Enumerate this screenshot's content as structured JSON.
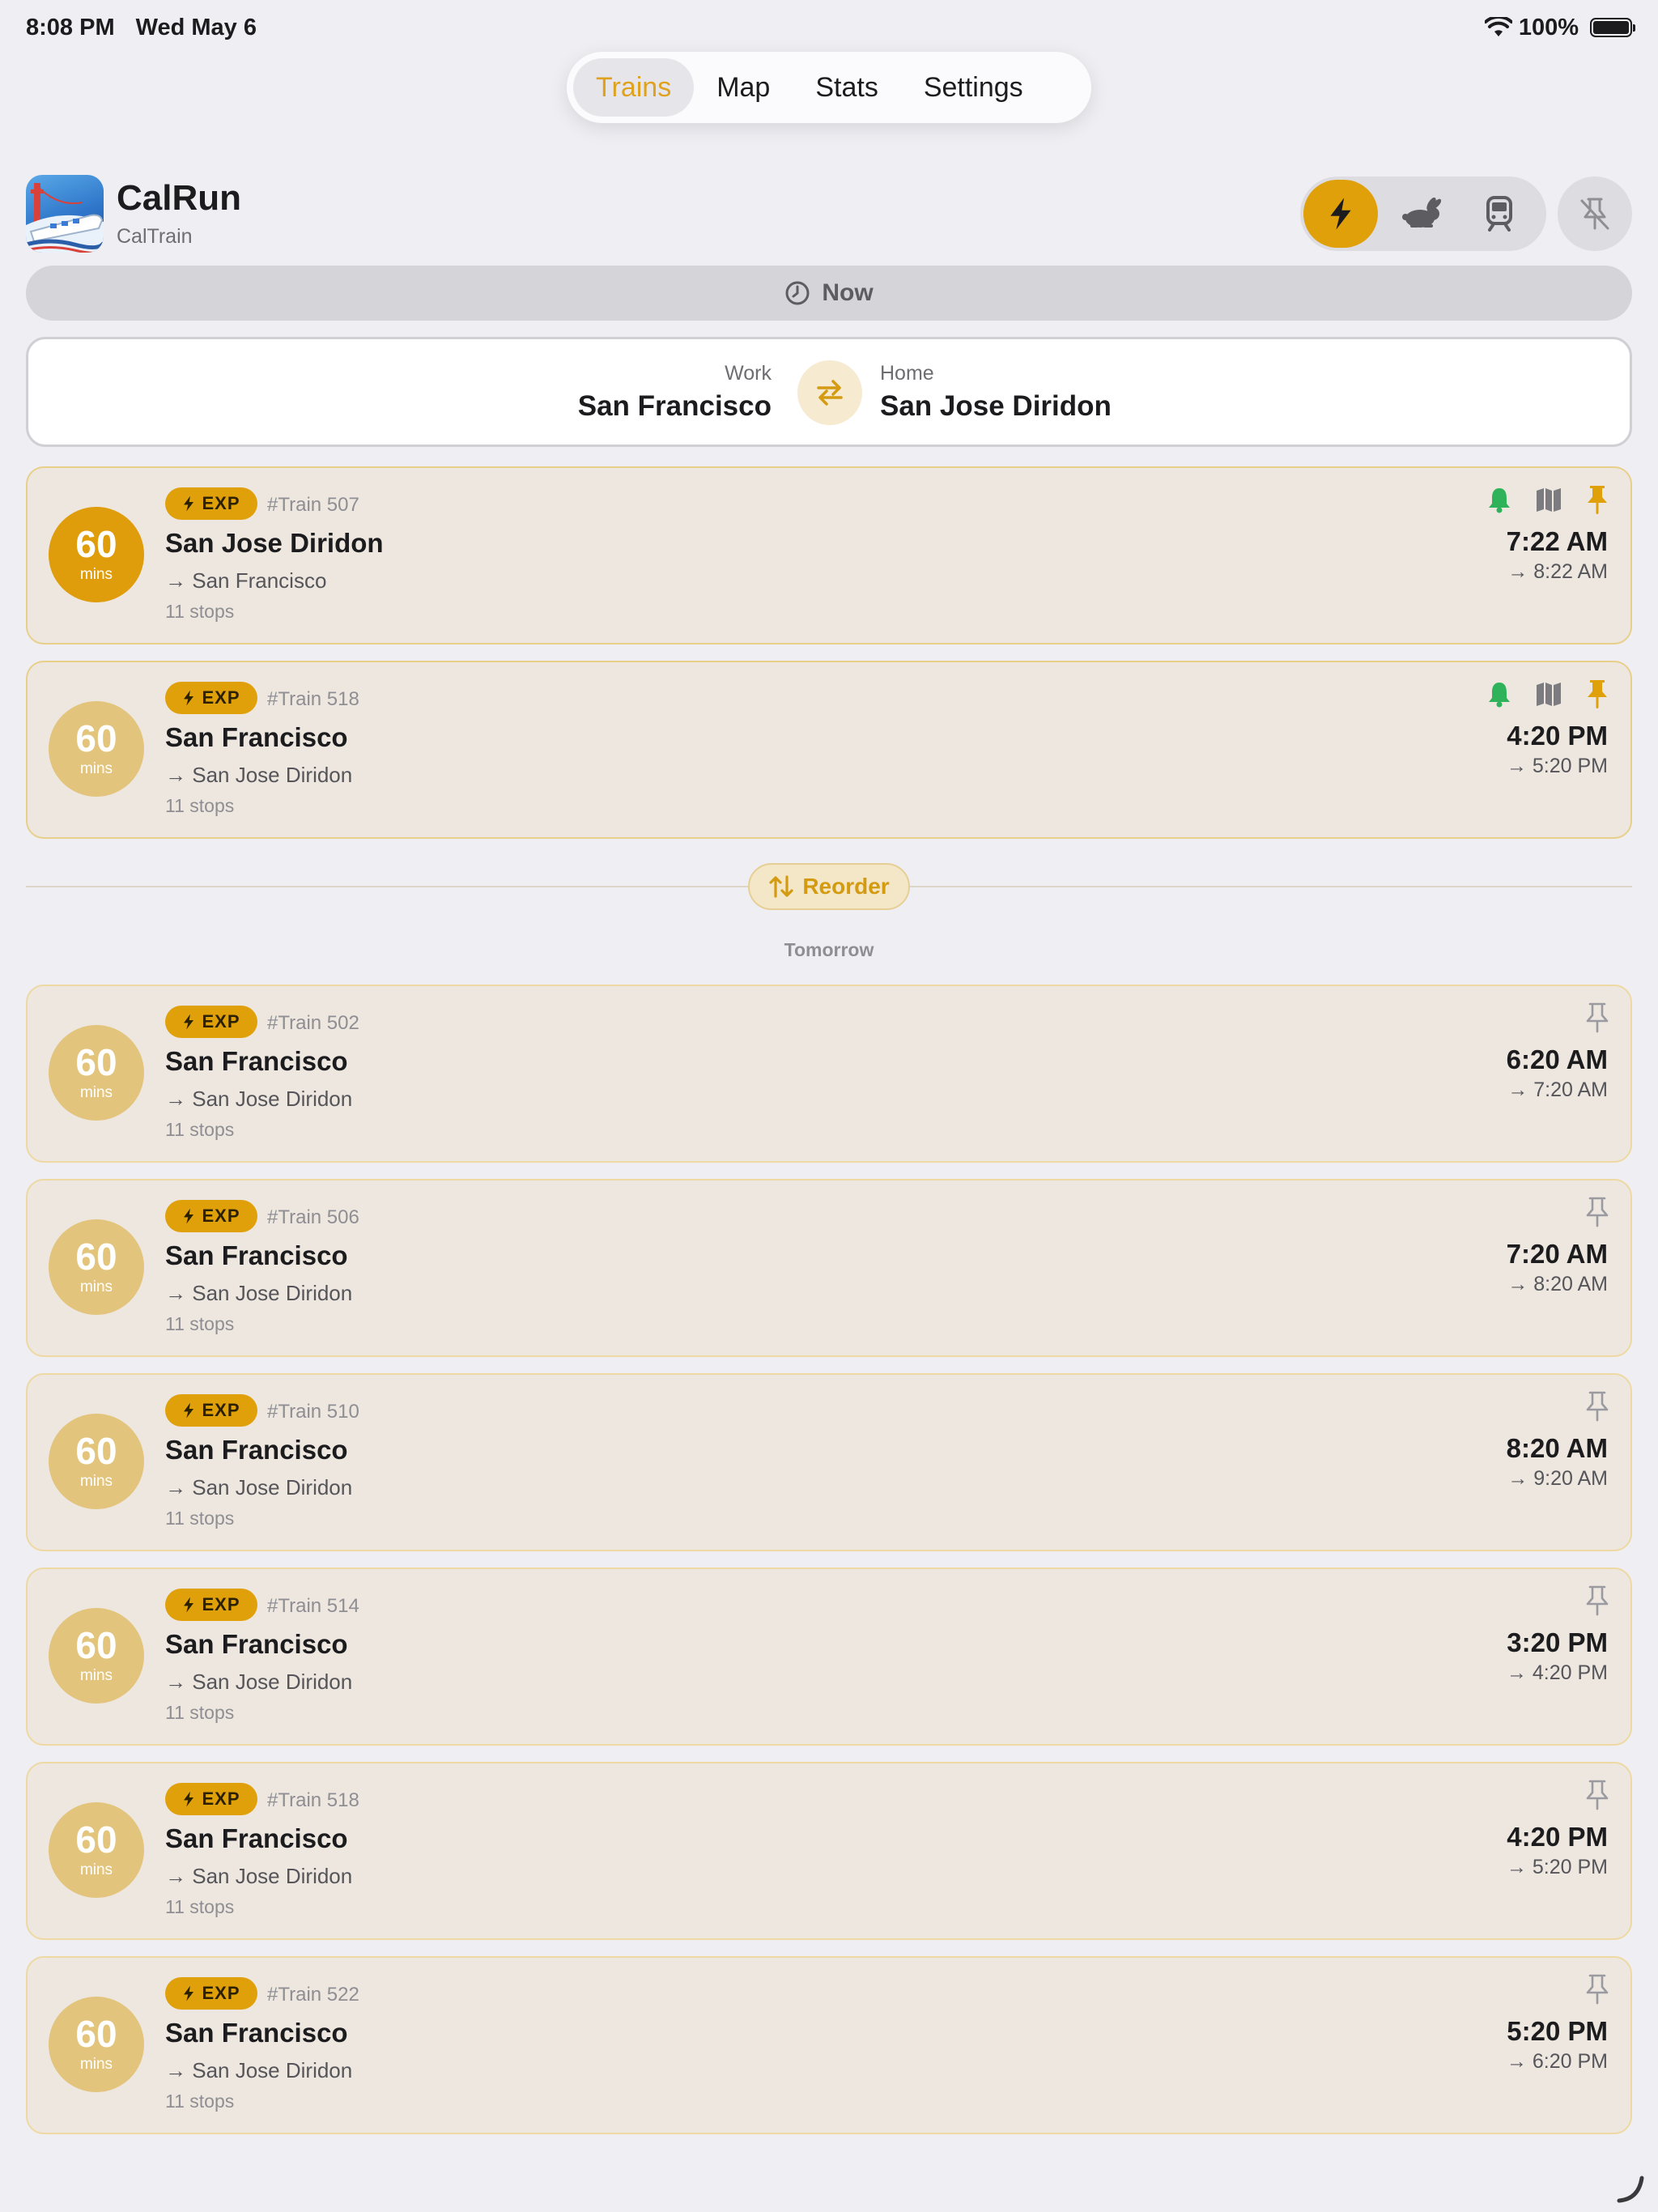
{
  "status_bar": {
    "time": "8:08 PM",
    "date": "Wed May 6",
    "battery": "100%"
  },
  "tabs": [
    {
      "label": "Trains",
      "active": true
    },
    {
      "label": "Map",
      "active": false
    },
    {
      "label": "Stats",
      "active": false
    },
    {
      "label": "Settings",
      "active": false
    }
  ],
  "header": {
    "title": "CalRun",
    "subtitle": "CalTrain",
    "filters": [
      {
        "icon": "lightning-icon",
        "active": true
      },
      {
        "icon": "rabbit-icon",
        "active": false
      },
      {
        "icon": "train-icon",
        "active": false
      }
    ],
    "unpin_icon": "pin-slash-icon"
  },
  "time_filter": {
    "label": "Now"
  },
  "route": {
    "from_label": "Work",
    "from_station": "San Francisco",
    "to_label": "Home",
    "to_station": "San Jose Diridon"
  },
  "colors": {
    "accent": "#e0a00a",
    "bell": "#2fb35a",
    "pin": "#e0a00a",
    "card_bg": "#ede7e0"
  },
  "pinned_trains": [
    {
      "duration": "60",
      "unit": "mins",
      "type": "EXP",
      "train_no": "#Train 507",
      "origin": "San Jose Diridon",
      "destination": "→ San Francisco",
      "stops": "11 stops",
      "depart": "7:22 AM",
      "arrive": "→ 8:22 AM",
      "highlight": true
    },
    {
      "duration": "60",
      "unit": "mins",
      "type": "EXP",
      "train_no": "#Train 518",
      "origin": "San Francisco",
      "destination": "→ San Jose Diridon",
      "stops": "11 stops",
      "depart": "4:20 PM",
      "arrive": "→ 5:20 PM",
      "highlight": false
    }
  ],
  "reorder_label": "Reorder",
  "section_label": "Tomorrow",
  "tomorrow_trains": [
    {
      "duration": "60",
      "unit": "mins",
      "type": "EXP",
      "train_no": "#Train 502",
      "origin": "San Francisco",
      "destination": "→ San Jose Diridon",
      "stops": "11 stops",
      "depart": "6:20 AM",
      "arrive": "→ 7:20 AM"
    },
    {
      "duration": "60",
      "unit": "mins",
      "type": "EXP",
      "train_no": "#Train 506",
      "origin": "San Francisco",
      "destination": "→ San Jose Diridon",
      "stops": "11 stops",
      "depart": "7:20 AM",
      "arrive": "→ 8:20 AM"
    },
    {
      "duration": "60",
      "unit": "mins",
      "type": "EXP",
      "train_no": "#Train 510",
      "origin": "San Francisco",
      "destination": "→ San Jose Diridon",
      "stops": "11 stops",
      "depart": "8:20 AM",
      "arrive": "→ 9:20 AM"
    },
    {
      "duration": "60",
      "unit": "mins",
      "type": "EXP",
      "train_no": "#Train 514",
      "origin": "San Francisco",
      "destination": "→ San Jose Diridon",
      "stops": "11 stops",
      "depart": "3:20 PM",
      "arrive": "→ 4:20 PM"
    },
    {
      "duration": "60",
      "unit": "mins",
      "type": "EXP",
      "train_no": "#Train 518",
      "origin": "San Francisco",
      "destination": "→ San Jose Diridon",
      "stops": "11 stops",
      "depart": "4:20 PM",
      "arrive": "→ 5:20 PM"
    },
    {
      "duration": "60",
      "unit": "mins",
      "type": "EXP",
      "train_no": "#Train 522",
      "origin": "San Francisco",
      "destination": "→ San Jose Diridon",
      "stops": "11 stops",
      "depart": "5:20 PM",
      "arrive": "→ 6:20 PM"
    }
  ]
}
